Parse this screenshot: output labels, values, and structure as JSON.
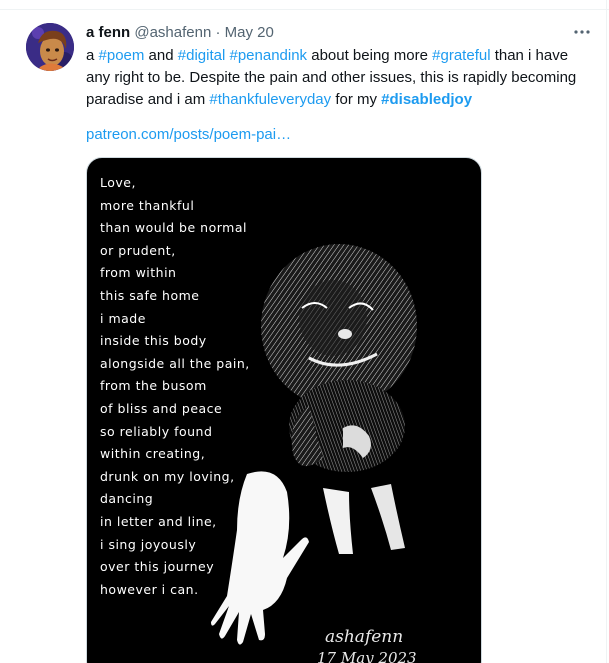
{
  "tweet": {
    "display_name": "a fenn",
    "handle": "@ashafenn",
    "separator": "·",
    "date": "May 20",
    "more_icon": "more-horizontal-icon",
    "text_parts": [
      {
        "t": "a ",
        "tag": false
      },
      {
        "t": "#poem",
        "tag": true
      },
      {
        "t": " and ",
        "tag": false
      },
      {
        "t": "#digital",
        "tag": true
      },
      {
        "t": " ",
        "tag": false
      },
      {
        "t": "#penandink",
        "tag": true
      },
      {
        "t": " about being more ",
        "tag": false
      },
      {
        "t": "#grateful",
        "tag": true
      },
      {
        "t": " than i have any right to be.  Despite the pain and other issues, this is rapidly becoming paradise and i am ",
        "tag": false
      },
      {
        "t": "#thankfuleveryday",
        "tag": true
      },
      {
        "t": " for my ",
        "tag": false
      },
      {
        "t": "#disabledjoy",
        "tag": true,
        "bold": true
      }
    ],
    "link_text": "patreon.com/posts/poem-pai…",
    "link_color": "#1d9bf0"
  },
  "media": {
    "poem_lines": [
      "Love,",
      "more thankful",
      "than would be normal",
      "or prudent,",
      "from within",
      "this safe home",
      "i made",
      "inside this body",
      "alongside all the pain,",
      "from the busom",
      "of bliss and peace",
      "so reliably found",
      "within creating,",
      "drunk on my loving,",
      "dancing",
      "in letter and line,",
      "i sing joyously",
      "over this journey",
      "however i can."
    ],
    "signature": "ashafenn",
    "signature_date": "17 May 2023"
  }
}
